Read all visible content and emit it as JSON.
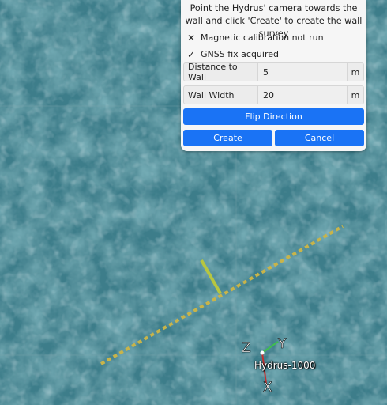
{
  "dialog": {
    "instruction": "Point the Hydrus' camera towards the wall and click 'Create' to create the wall survey",
    "status_mag": "Magnetic calibration not run",
    "status_gnss": "GNSS fix acquired",
    "distance_label": "Distance to Wall",
    "distance_value": "5",
    "distance_unit": "m",
    "width_label": "Wall Width",
    "width_value": "20",
    "width_unit": "m",
    "flip_label": "Flip Direction",
    "create_label": "Create",
    "cancel_label": "Cancel"
  },
  "icons": {
    "mag_status": "cross-icon",
    "gnss_status": "checkmark-icon"
  },
  "colors": {
    "accent": "#1a73f5",
    "wall_line": "#c8b44a",
    "axis_y": "#3fbf4f",
    "axis_x": "#c23030"
  },
  "scene": {
    "vehicle_label": "Hydrus-1000",
    "axis_z": "Z",
    "axis_y": "Y",
    "axis_x": "X"
  }
}
